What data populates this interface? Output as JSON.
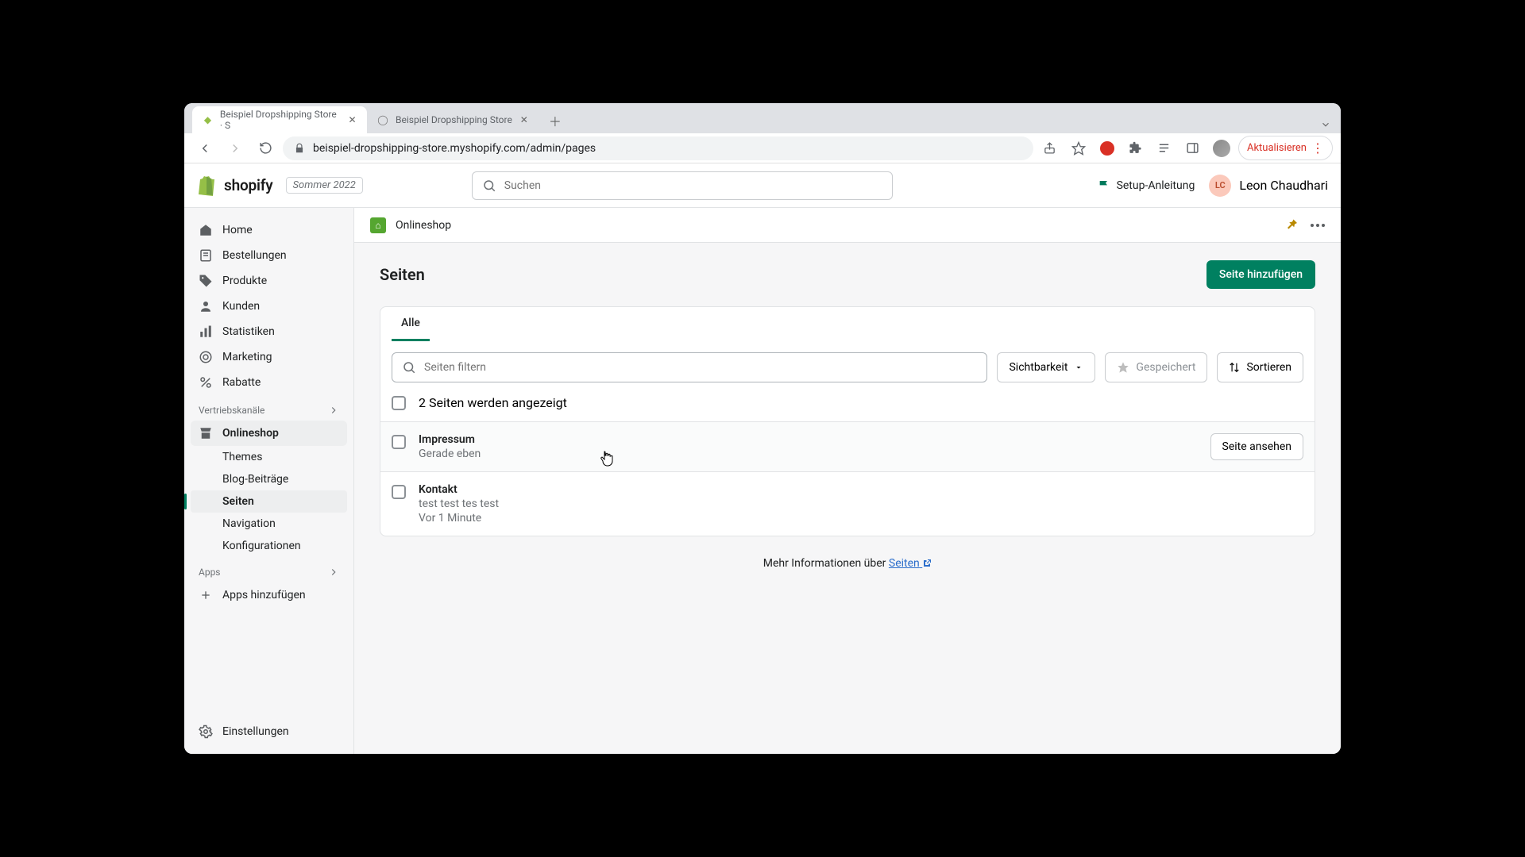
{
  "browser": {
    "tabs": [
      {
        "title": "Beispiel Dropshipping Store · S",
        "active": true
      },
      {
        "title": "Beispiel Dropshipping Store",
        "active": false
      }
    ],
    "url": "beispiel-dropshipping-store.myshopify.com/admin/pages",
    "update_label": "Aktualisieren"
  },
  "topbar": {
    "brand": "shopify",
    "tag": "Sommer 2022",
    "search_placeholder": "Suchen",
    "setup_guide": "Setup-Anleitung",
    "user_initials": "LC",
    "user_name": "Leon Chaudhari"
  },
  "sidebar": {
    "items": [
      {
        "label": "Home"
      },
      {
        "label": "Bestellungen"
      },
      {
        "label": "Produkte"
      },
      {
        "label": "Kunden"
      },
      {
        "label": "Statistiken"
      },
      {
        "label": "Marketing"
      },
      {
        "label": "Rabatte"
      }
    ],
    "section_channels": "Vertriebskanäle",
    "onlineshop": "Onlineshop",
    "onlineshop_subs": [
      {
        "label": "Themes"
      },
      {
        "label": "Blog-Beiträge"
      },
      {
        "label": "Seiten",
        "active": true
      },
      {
        "label": "Navigation"
      },
      {
        "label": "Konfigurationen"
      }
    ],
    "section_apps": "Apps",
    "add_apps": "Apps hinzufügen",
    "settings": "Einstellungen"
  },
  "crumb": {
    "title": "Onlineshop"
  },
  "page": {
    "title": "Seiten",
    "add_button": "Seite hinzufügen",
    "tab_all": "Alle",
    "filter_placeholder": "Seiten filtern",
    "visibility": "Sichtbarkeit",
    "saved": "Gespeichert",
    "sort": "Sortieren",
    "count_text": "2 Seiten werden angezeigt",
    "view_button": "Seite ansehen",
    "rows": [
      {
        "title": "Impressum",
        "meta": "Gerade eben",
        "show_view": true
      },
      {
        "title": "Kontakt",
        "excerpt": "test test tes test",
        "meta": "Vor 1 Minute",
        "show_view": false
      }
    ],
    "footer_text": "Mehr Informationen über ",
    "footer_link": "Seiten"
  }
}
